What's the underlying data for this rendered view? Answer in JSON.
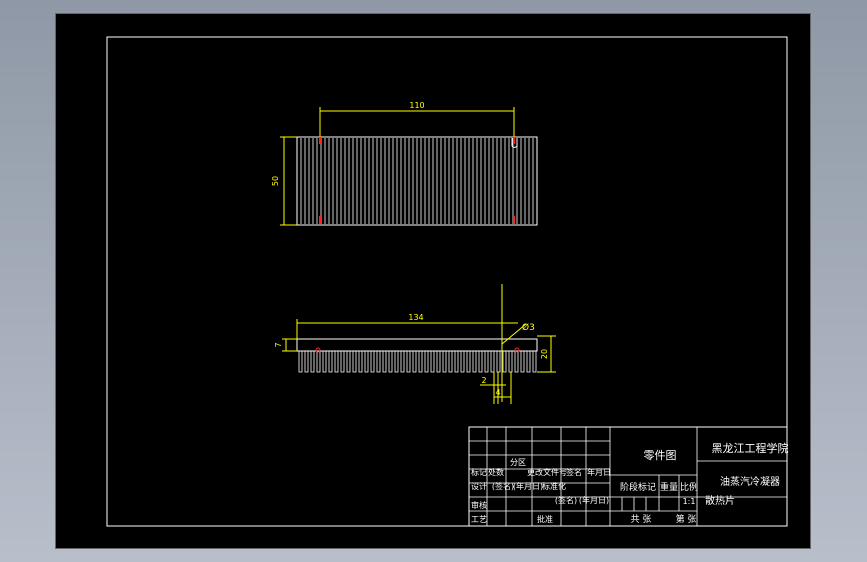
{
  "colors": {
    "background": "#000000",
    "outline": "#ffffff",
    "dimension": "#ffff00",
    "accent": "#ff2020",
    "titlebar_text": "#ffffff"
  },
  "top_view": {
    "dim_length": "110",
    "dim_height": "50"
  },
  "side_view": {
    "dim_length": "134",
    "dim_height": "20",
    "dim_base": "7",
    "dim_diameter": "Ø3",
    "dim_fin_gap": "2",
    "dim_pitch": "4"
  },
  "title_block": {
    "drawing_type": "零件图",
    "institution": "黑龙江工程学院",
    "product": "油蒸汽冷凝器",
    "part_name": "散热片",
    "col_stage_mark": "阶段标记",
    "col_weight": "重量",
    "col_scale": "比例",
    "scale_value": "1:1",
    "total_sheets": "共 张",
    "sheet_no": "第 张",
    "cells": {
      "mark": "标记",
      "count": "处数",
      "zone": "分区",
      "change_doc": "更改文件号",
      "signature": "签名",
      "date": "年月日",
      "design": "设计",
      "sign2": "(签名)",
      "date2": "(年月日)",
      "standardize": "标准化",
      "sign3": "(签名)",
      "date3": "(年月日)",
      "review": "审核",
      "process": "工艺",
      "approve": "批准"
    }
  }
}
